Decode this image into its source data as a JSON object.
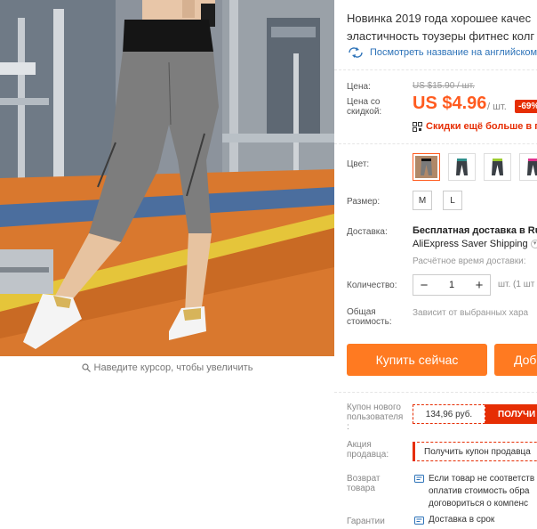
{
  "gallery": {
    "zoom_hint": "Наведите курсор, чтобы увеличить"
  },
  "product": {
    "title_line1": "Новинка 2019 года хорошее качес",
    "title_line2": "эластичность тоузеры фитнес колг",
    "translate_label": "Посмотреть название на английском"
  },
  "price": {
    "price_label": "Цена:",
    "old_price": "US $15.90 / шт.",
    "discount_label_line1": "Цена со",
    "discount_label_line2": "скидкой:",
    "current_price": "US $4.96",
    "unit": "/ шт.",
    "discount_badge": "-69%",
    "coupon_link": "Скидки ещё больше в пр"
  },
  "variants": {
    "color_label": "Цвет:",
    "colors": [
      {
        "name": "gray-photo",
        "accent": "#7a7a7a"
      },
      {
        "name": "teal",
        "accent": "#2f8f8c"
      },
      {
        "name": "lime",
        "accent": "#9ccc2f"
      },
      {
        "name": "pink",
        "accent": "#e0338f"
      }
    ],
    "size_label": "Размер:",
    "sizes": [
      "M",
      "L"
    ]
  },
  "shipping": {
    "label": "Доставка:",
    "title": "Бесплатная доставка в Ru",
    "method": "AliExpress Saver Shipping",
    "estimate": "Расчётное время доставки:"
  },
  "quantity": {
    "label": "Количество:",
    "value": "1",
    "unit": "шт. (1 шт"
  },
  "total": {
    "label_line1": "Общая",
    "label_line2": "стоимость:",
    "value": "Зависит от выбранных хара"
  },
  "actions": {
    "buy_now": "Купить сейчас",
    "add_to_cart": "Доб"
  },
  "coupons": {
    "new_user_label_line1": "Купон нового",
    "new_user_label_line2": "пользователя",
    "new_user_label_line3": ":",
    "new_user_value": "134,96 руб.",
    "new_user_button": "ПОЛУЧИ",
    "seller_label_line1": "Акция",
    "seller_label_line2": "продавца:",
    "seller_button": "Получить купон продавца"
  },
  "returns": {
    "label_line1": "Возврат",
    "label_line2": "товара",
    "text_line1": "Если товар не соответств",
    "text_line2": "оплатив стоимость обра",
    "text_line3": "договориться о компенс"
  },
  "guarantees": {
    "label": "Гарантии",
    "text": "Доставка в срок"
  },
  "colors": {
    "accent_orange": "#ff7a21",
    "price_orange": "#ff5b1f",
    "sale_red": "#e62e04",
    "link_blue": "#2c72b8"
  }
}
